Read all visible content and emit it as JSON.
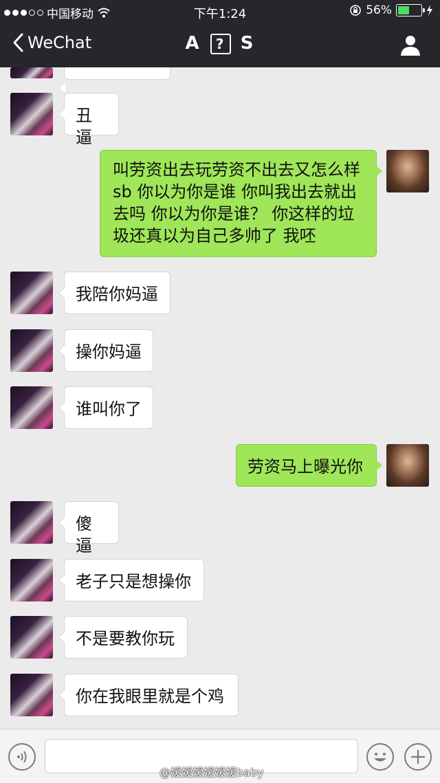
{
  "status_bar": {
    "carrier": "中国移动",
    "time": "下午1:24",
    "battery": "56%",
    "battery_level": 0.56
  },
  "nav": {
    "back_label": "WeChat",
    "title_left": "A",
    "title_box": "?",
    "title_right": "S"
  },
  "messages": [
    {
      "side": "left",
      "text": ""
    },
    {
      "side": "left",
      "text": "丑逼"
    },
    {
      "side": "right",
      "lines": [
        "叫劳资出去玩劳资不出去又怎么样",
        "sb 你以为你是谁 你叫我出去就出",
        "去吗 你以为你是谁？ 你这样的垃",
        "圾还真以为自己多帅了 我呸"
      ]
    },
    {
      "side": "left",
      "text": "我陪你妈逼"
    },
    {
      "side": "left",
      "text": "操你妈逼"
    },
    {
      "side": "left",
      "text": "谁叫你了"
    },
    {
      "side": "right",
      "text": "劳资马上曝光你"
    },
    {
      "side": "left",
      "text": "傻逼"
    },
    {
      "side": "left",
      "text": "老子只是想操你"
    },
    {
      "side": "left",
      "text": "不是要教你玩"
    },
    {
      "side": "left",
      "text": "你在我眼里就是个鸡"
    }
  ],
  "watermark": "@嫒嫒嫒嫒嫒嫒baby",
  "icons": [
    "wifi-icon",
    "lock-rotation-icon",
    "charging-icon",
    "back-chevron-icon",
    "profile-icon",
    "voice-icon",
    "emoji-icon",
    "plus-icon"
  ]
}
